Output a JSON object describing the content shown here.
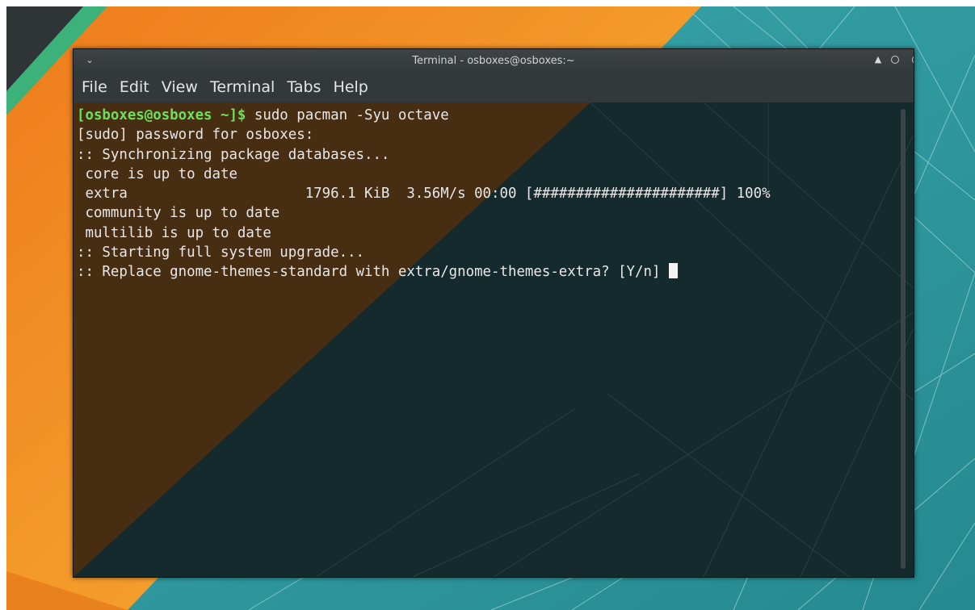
{
  "window": {
    "title": "Terminal - osboxes@osboxes:~",
    "menu_icon": "chevron-down-icon",
    "controls": [
      "keep-above-icon",
      "minimize-icon",
      "maximize-icon",
      "close-icon"
    ]
  },
  "menubar": {
    "items": [
      "File",
      "Edit",
      "View",
      "Terminal",
      "Tabs",
      "Help"
    ]
  },
  "terminal": {
    "prompt": "[osboxes@osboxes ~]$",
    "command": " sudo pacman -Syu octave",
    "lines": [
      "[sudo] password for osboxes:",
      ":: Synchronizing package databases...",
      " core is up to date",
      " extra                     1796.1 KiB  3.56M/s 00:00 [######################] 100%",
      " community is up to date",
      " multilib is up to date",
      ":: Starting full system upgrade...",
      ":: Replace gnome-themes-standard with extra/gnome-themes-extra? [Y/n] "
    ],
    "colors": {
      "prompt": "#6ee05a",
      "text": "#e8e8e8",
      "background": "#1a2a2c"
    }
  },
  "wallpaper": {
    "colors": {
      "teal": "#2a8f95",
      "orange": "#f28a1f",
      "green_stripe": "#3cb27a",
      "dark": "#2b2f33"
    }
  }
}
